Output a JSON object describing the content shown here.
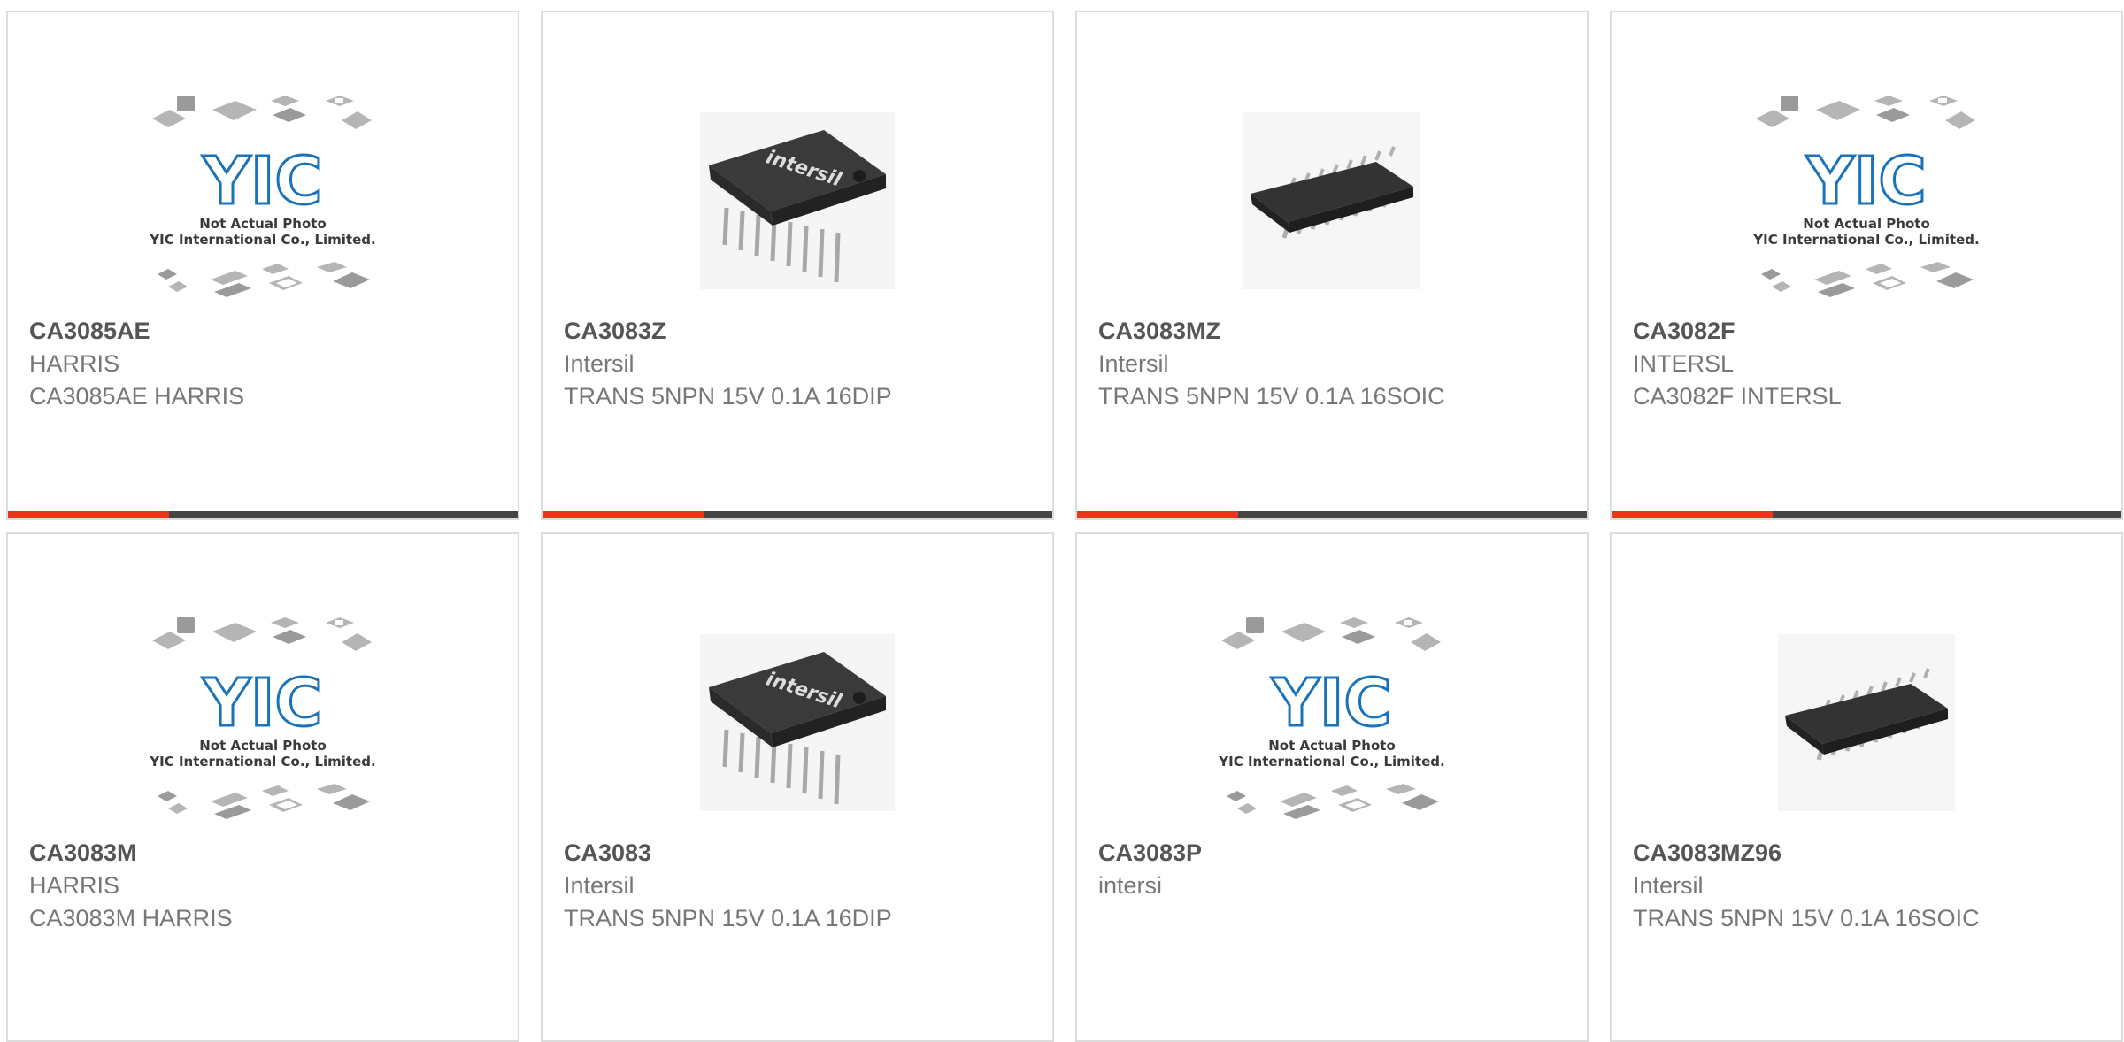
{
  "colors": {
    "accent": "#e8381c",
    "bar": "#454545",
    "border": "#dcdcdc",
    "logo_blue": "#1a73b8"
  },
  "products": [
    {
      "part": "CA3085AE",
      "mfr": "HARRIS",
      "desc": "CA3085AE HARRIS",
      "image": "placeholder",
      "icon": "yic-not-actual-photo"
    },
    {
      "part": "CA3083Z",
      "mfr": "Intersil",
      "desc": "TRANS 5NPN 15V 0.1A 16DIP",
      "image": "dip",
      "icon": "dip16-chip",
      "chip_brand": "intersil"
    },
    {
      "part": "CA3083MZ",
      "mfr": "Intersil",
      "desc": "TRANS 5NPN 15V 0.1A 16SOIC",
      "image": "soic",
      "icon": "soic16-chip"
    },
    {
      "part": "CA3082F",
      "mfr": "INTERSL",
      "desc": "CA3082F INTERSL",
      "image": "placeholder",
      "icon": "yic-not-actual-photo"
    },
    {
      "part": "CA3083M",
      "mfr": "HARRIS",
      "desc": "CA3083M HARRIS",
      "image": "placeholder",
      "icon": "yic-not-actual-photo"
    },
    {
      "part": "CA3083",
      "mfr": "Intersil",
      "desc": "TRANS 5NPN 15V 0.1A 16DIP",
      "image": "dip",
      "icon": "dip16-chip",
      "chip_brand": "intersil"
    },
    {
      "part": "CA3083P",
      "mfr": "intersi",
      "desc": "",
      "image": "placeholder",
      "icon": "yic-not-actual-photo"
    },
    {
      "part": "CA3083MZ96",
      "mfr": "Intersil",
      "desc": "TRANS 5NPN 15V 0.1A 16SOIC",
      "image": "soic",
      "icon": "soic16-chip"
    }
  ],
  "placeholder_logo": {
    "brand": "YIC",
    "line1": "Not Actual Photo",
    "line2": "YIC International Co., Limited."
  }
}
